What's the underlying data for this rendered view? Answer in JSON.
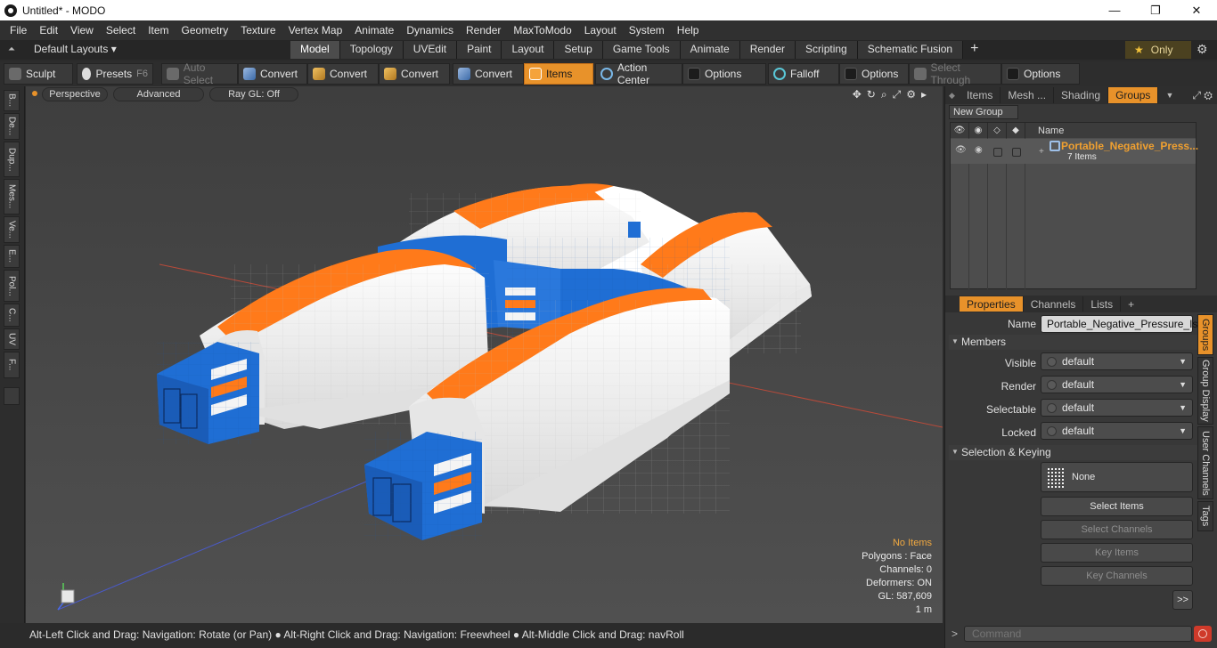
{
  "window": {
    "title": "Untitled* - MODO",
    "min": "—",
    "max": "❐",
    "close": "✕"
  },
  "menu": [
    "File",
    "Edit",
    "View",
    "Select",
    "Item",
    "Geometry",
    "Texture",
    "Vertex Map",
    "Animate",
    "Dynamics",
    "Render",
    "MaxToModo",
    "Layout",
    "System",
    "Help"
  ],
  "layouts": {
    "label": "Default Layouts ▾"
  },
  "tabs": [
    "Model",
    "Topology",
    "UVEdit",
    "Paint",
    "Layout",
    "Setup",
    "Game Tools",
    "Animate",
    "Render",
    "Scripting",
    "Schematic Fusion",
    "+"
  ],
  "only": {
    "star": "★",
    "label": "Only"
  },
  "toolbar": {
    "sculpt": "Sculpt",
    "presets": "Presets",
    "presets_key": "F6",
    "auto_select": "Auto Select",
    "convert": "Convert",
    "items": "Items",
    "action_center": "Action Center",
    "options": "Options",
    "falloff": "Falloff",
    "select_through": "Select Through"
  },
  "left_tabs": [
    "B...",
    "De...",
    "Dup...",
    "Mes...",
    "Ve...",
    "E...",
    "Pol...",
    "C...",
    "UV",
    "F..."
  ],
  "viewport": {
    "view": "Perspective",
    "mode": "Advanced",
    "raygl": "Ray GL: Off",
    "stats": {
      "no_items": "No Items",
      "polygons": "Polygons : Face",
      "channels": "Channels: 0",
      "deformers": "Deformers: ON",
      "gl": "GL: 587,609",
      "unit": "1 m"
    },
    "colors": {
      "tent_white": "#f4f4f4",
      "tent_orange": "#ff7a1a",
      "tent_blue": "#1f6ed4"
    }
  },
  "status": "Alt-Left Click and Drag: Navigation: Rotate (or Pan) ● Alt-Right Click and Drag: Navigation: Freewheel ● Alt-Middle Click and Drag: navRoll",
  "groups_panel": {
    "tabs": [
      "Items",
      "Mesh ...",
      "Shading",
      "Groups"
    ],
    "new_group": "New Group",
    "col_name": "Name",
    "group_name": "Portable_Negative_Press...",
    "group_count": "7 Items"
  },
  "properties": {
    "tabs": [
      "Properties",
      "Channels",
      "Lists",
      "+"
    ],
    "name_label": "Name",
    "name_value": "Portable_Negative_Pressure_Iso",
    "members_section": "Members",
    "visible_label": "Visible",
    "render_label": "Render",
    "selectable_label": "Selectable",
    "locked_label": "Locked",
    "default_value": "default",
    "selection_section": "Selection & Keying",
    "none": "None",
    "select_items": "Select Items",
    "select_channels": "Select Channels",
    "key_items": "Key Items",
    "key_channels": "Key Channels",
    "more": ">>",
    "side_tabs": [
      "Groups",
      "Group Display",
      "User Channels",
      "Tags"
    ],
    "command_placeholder": "Command"
  }
}
